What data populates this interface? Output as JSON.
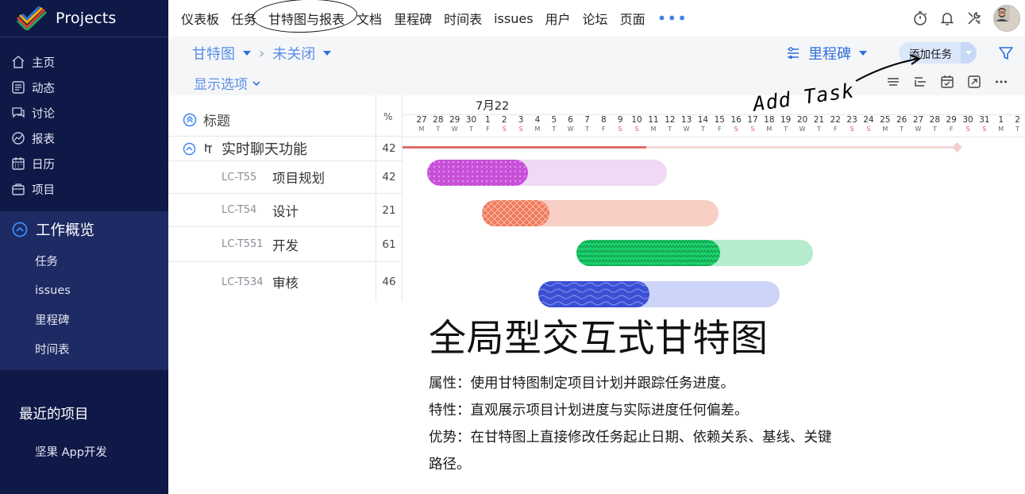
{
  "brand": {
    "name": "Projects"
  },
  "sidebar": {
    "nav": [
      {
        "label": "主页",
        "icon": "home-icon"
      },
      {
        "label": "动态",
        "icon": "feed-icon"
      },
      {
        "label": "讨论",
        "icon": "discussion-icon"
      },
      {
        "label": "报表",
        "icon": "report-icon"
      },
      {
        "label": "日历",
        "icon": "calendar-icon"
      },
      {
        "label": "项目",
        "icon": "project-icon"
      }
    ],
    "workspace": {
      "title": "工作概览",
      "items": [
        "任务",
        "issues",
        "里程碑",
        "时间表"
      ]
    },
    "recent": {
      "title": "最近的项目",
      "items": [
        "坚果 App开发"
      ]
    }
  },
  "topnav": {
    "items": [
      "仪表板",
      "任务",
      "甘特图与报表",
      "文档",
      "里程碑",
      "时间表",
      "issues",
      "用户",
      "论坛",
      "页面"
    ],
    "active_index": 2,
    "more": "•••",
    "icons": [
      "timer-icon",
      "bell-icon",
      "tools-icon"
    ]
  },
  "toolbar": {
    "view": "甘特图",
    "separator": "›",
    "filter_status": "未关闭",
    "milestone_label": "里程碑",
    "add_task": "添加任务",
    "show_options": "显示选项",
    "view_icons": [
      "collapse-rows-icon",
      "indent-icon",
      "calendar-check-icon",
      "expand-icon",
      "more-horizontal-icon"
    ]
  },
  "annotation": {
    "text": "Add Task"
  },
  "table": {
    "header_title": "标题",
    "header_pct": "%",
    "parent": {
      "name": "实时聊天功能",
      "pct": "42"
    },
    "tasks": [
      {
        "id": "LC-T55",
        "name": "项目规划",
        "pct": "42"
      },
      {
        "id": "LC-T54",
        "name": "设计",
        "pct": "21"
      },
      {
        "id": "LC-T551",
        "name": "开发",
        "pct": "61"
      },
      {
        "id": "LC-T534",
        "name": "审核",
        "pct": "46"
      }
    ]
  },
  "gantt": {
    "month_label": "7月22",
    "days": [
      {
        "d": "27",
        "w": "M"
      },
      {
        "d": "28",
        "w": "T"
      },
      {
        "d": "29",
        "w": "W"
      },
      {
        "d": "30",
        "w": "T"
      },
      {
        "d": "1",
        "w": "F"
      },
      {
        "d": "2",
        "w": "S"
      },
      {
        "d": "3",
        "w": "S"
      },
      {
        "d": "4",
        "w": "M"
      },
      {
        "d": "5",
        "w": "T"
      },
      {
        "d": "6",
        "w": "W"
      },
      {
        "d": "7",
        "w": "T"
      },
      {
        "d": "8",
        "w": "F"
      },
      {
        "d": "9",
        "w": "S"
      },
      {
        "d": "10",
        "w": "S"
      },
      {
        "d": "11",
        "w": "M"
      },
      {
        "d": "12",
        "w": "T"
      },
      {
        "d": "13",
        "w": "W"
      },
      {
        "d": "14",
        "w": "T"
      },
      {
        "d": "15",
        "w": "F"
      },
      {
        "d": "16",
        "w": "S"
      },
      {
        "d": "17",
        "w": "S"
      },
      {
        "d": "18",
        "w": "M"
      },
      {
        "d": "19",
        "w": "T"
      },
      {
        "d": "20",
        "w": "W"
      },
      {
        "d": "21",
        "w": "T"
      },
      {
        "d": "22",
        "w": "F"
      },
      {
        "d": "23",
        "w": "S"
      },
      {
        "d": "24",
        "w": "S"
      },
      {
        "d": "25",
        "w": "M"
      },
      {
        "d": "26",
        "w": "T"
      },
      {
        "d": "27",
        "w": "W"
      },
      {
        "d": "28",
        "w": "T"
      },
      {
        "d": "29",
        "w": "F"
      },
      {
        "d": "30",
        "w": "S"
      },
      {
        "d": "31",
        "w": "S"
      },
      {
        "d": "1",
        "w": "M"
      },
      {
        "d": "2",
        "w": "T"
      }
    ],
    "summary": {
      "start": 0,
      "end": 33.5,
      "progress": 0.44
    },
    "bars": [
      {
        "task": "LC-T55",
        "start": 1,
        "end": 15.5,
        "progress": 0.42,
        "color": "#c84fd8",
        "track": "#efd9f5",
        "pattern": "dots"
      },
      {
        "task": "LC-T54",
        "start": 4.3,
        "end": 18.6,
        "progress": 0.285,
        "color": "#f07858",
        "track": "#f7cfc4",
        "pattern": "cross"
      },
      {
        "task": "LC-T551",
        "start": 10,
        "end": 24.3,
        "progress": 0.61,
        "color": "#1ed36e",
        "track": "#b5ecce",
        "pattern": "zigzag"
      },
      {
        "task": "LC-T534",
        "start": 7.7,
        "end": 22.3,
        "progress": 0.46,
        "color": "#3c4fd4",
        "track": "#ccd4f7",
        "pattern": "wave"
      }
    ]
  },
  "info": {
    "title": "全局型交互式甘特图",
    "lines": [
      "属性：使用甘特图制定项目计划并跟踪任务进度。",
      "特性：直观展示项目计划进度与实际进度任何偏差。",
      "优势：在甘特图上直接修改任务起止日期、依赖关系、基线、关键",
      "路径。"
    ]
  }
}
